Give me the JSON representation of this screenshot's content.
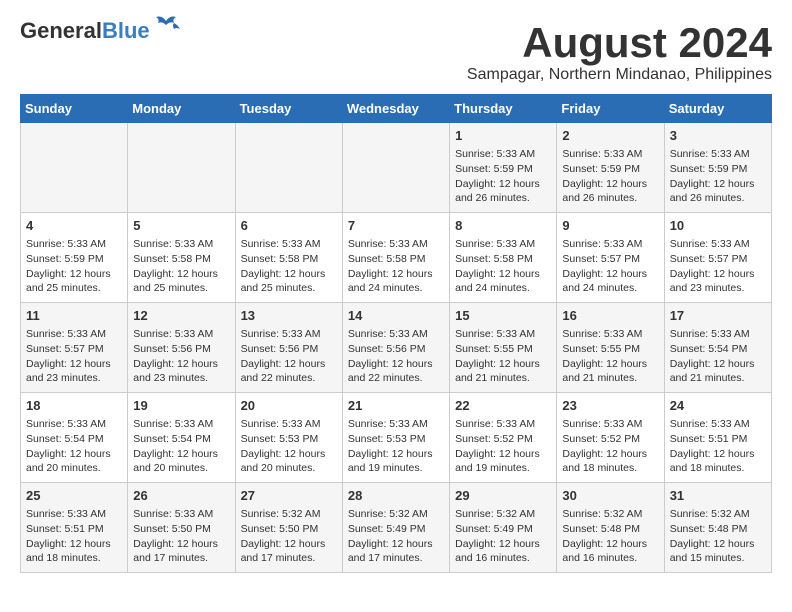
{
  "header": {
    "logo_line1": "General",
    "logo_line2": "Blue",
    "title": "August 2024",
    "subtitle": "Sampagar, Northern Mindanao, Philippines"
  },
  "weekdays": [
    "Sunday",
    "Monday",
    "Tuesday",
    "Wednesday",
    "Thursday",
    "Friday",
    "Saturday"
  ],
  "weeks": [
    [
      {
        "day": "",
        "info": ""
      },
      {
        "day": "",
        "info": ""
      },
      {
        "day": "",
        "info": ""
      },
      {
        "day": "",
        "info": ""
      },
      {
        "day": "1",
        "info": "Sunrise: 5:33 AM\nSunset: 5:59 PM\nDaylight: 12 hours\nand 26 minutes."
      },
      {
        "day": "2",
        "info": "Sunrise: 5:33 AM\nSunset: 5:59 PM\nDaylight: 12 hours\nand 26 minutes."
      },
      {
        "day": "3",
        "info": "Sunrise: 5:33 AM\nSunset: 5:59 PM\nDaylight: 12 hours\nand 26 minutes."
      }
    ],
    [
      {
        "day": "4",
        "info": "Sunrise: 5:33 AM\nSunset: 5:59 PM\nDaylight: 12 hours\nand 25 minutes."
      },
      {
        "day": "5",
        "info": "Sunrise: 5:33 AM\nSunset: 5:58 PM\nDaylight: 12 hours\nand 25 minutes."
      },
      {
        "day": "6",
        "info": "Sunrise: 5:33 AM\nSunset: 5:58 PM\nDaylight: 12 hours\nand 25 minutes."
      },
      {
        "day": "7",
        "info": "Sunrise: 5:33 AM\nSunset: 5:58 PM\nDaylight: 12 hours\nand 24 minutes."
      },
      {
        "day": "8",
        "info": "Sunrise: 5:33 AM\nSunset: 5:58 PM\nDaylight: 12 hours\nand 24 minutes."
      },
      {
        "day": "9",
        "info": "Sunrise: 5:33 AM\nSunset: 5:57 PM\nDaylight: 12 hours\nand 24 minutes."
      },
      {
        "day": "10",
        "info": "Sunrise: 5:33 AM\nSunset: 5:57 PM\nDaylight: 12 hours\nand 23 minutes."
      }
    ],
    [
      {
        "day": "11",
        "info": "Sunrise: 5:33 AM\nSunset: 5:57 PM\nDaylight: 12 hours\nand 23 minutes."
      },
      {
        "day": "12",
        "info": "Sunrise: 5:33 AM\nSunset: 5:56 PM\nDaylight: 12 hours\nand 23 minutes."
      },
      {
        "day": "13",
        "info": "Sunrise: 5:33 AM\nSunset: 5:56 PM\nDaylight: 12 hours\nand 22 minutes."
      },
      {
        "day": "14",
        "info": "Sunrise: 5:33 AM\nSunset: 5:56 PM\nDaylight: 12 hours\nand 22 minutes."
      },
      {
        "day": "15",
        "info": "Sunrise: 5:33 AM\nSunset: 5:55 PM\nDaylight: 12 hours\nand 21 minutes."
      },
      {
        "day": "16",
        "info": "Sunrise: 5:33 AM\nSunset: 5:55 PM\nDaylight: 12 hours\nand 21 minutes."
      },
      {
        "day": "17",
        "info": "Sunrise: 5:33 AM\nSunset: 5:54 PM\nDaylight: 12 hours\nand 21 minutes."
      }
    ],
    [
      {
        "day": "18",
        "info": "Sunrise: 5:33 AM\nSunset: 5:54 PM\nDaylight: 12 hours\nand 20 minutes."
      },
      {
        "day": "19",
        "info": "Sunrise: 5:33 AM\nSunset: 5:54 PM\nDaylight: 12 hours\nand 20 minutes."
      },
      {
        "day": "20",
        "info": "Sunrise: 5:33 AM\nSunset: 5:53 PM\nDaylight: 12 hours\nand 20 minutes."
      },
      {
        "day": "21",
        "info": "Sunrise: 5:33 AM\nSunset: 5:53 PM\nDaylight: 12 hours\nand 19 minutes."
      },
      {
        "day": "22",
        "info": "Sunrise: 5:33 AM\nSunset: 5:52 PM\nDaylight: 12 hours\nand 19 minutes."
      },
      {
        "day": "23",
        "info": "Sunrise: 5:33 AM\nSunset: 5:52 PM\nDaylight: 12 hours\nand 18 minutes."
      },
      {
        "day": "24",
        "info": "Sunrise: 5:33 AM\nSunset: 5:51 PM\nDaylight: 12 hours\nand 18 minutes."
      }
    ],
    [
      {
        "day": "25",
        "info": "Sunrise: 5:33 AM\nSunset: 5:51 PM\nDaylight: 12 hours\nand 18 minutes."
      },
      {
        "day": "26",
        "info": "Sunrise: 5:33 AM\nSunset: 5:50 PM\nDaylight: 12 hours\nand 17 minutes."
      },
      {
        "day": "27",
        "info": "Sunrise: 5:32 AM\nSunset: 5:50 PM\nDaylight: 12 hours\nand 17 minutes."
      },
      {
        "day": "28",
        "info": "Sunrise: 5:32 AM\nSunset: 5:49 PM\nDaylight: 12 hours\nand 17 minutes."
      },
      {
        "day": "29",
        "info": "Sunrise: 5:32 AM\nSunset: 5:49 PM\nDaylight: 12 hours\nand 16 minutes."
      },
      {
        "day": "30",
        "info": "Sunrise: 5:32 AM\nSunset: 5:48 PM\nDaylight: 12 hours\nand 16 minutes."
      },
      {
        "day": "31",
        "info": "Sunrise: 5:32 AM\nSunset: 5:48 PM\nDaylight: 12 hours\nand 15 minutes."
      }
    ]
  ]
}
